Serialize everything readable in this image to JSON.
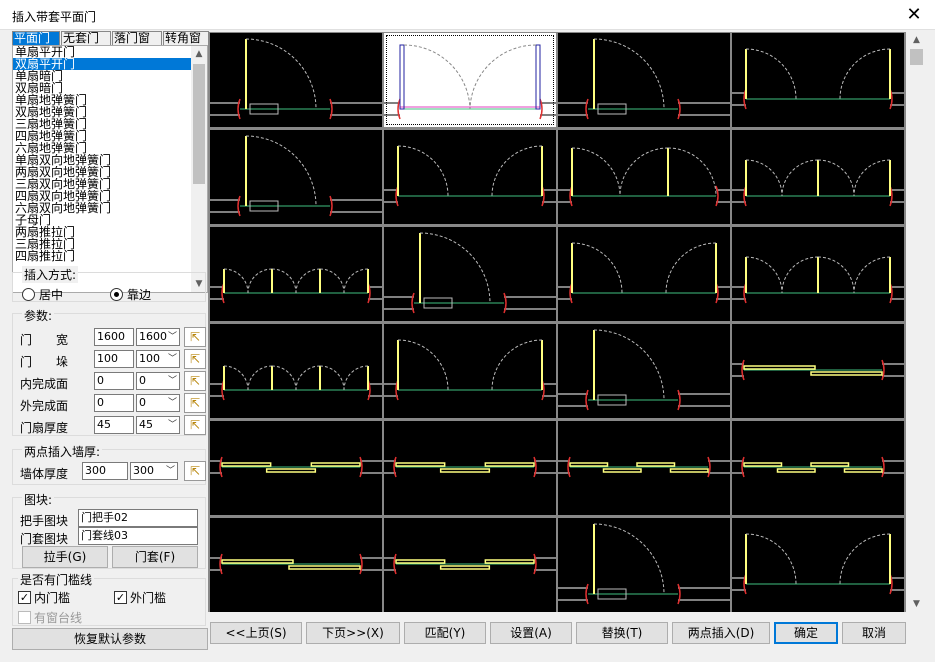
{
  "window": {
    "title": "插入带套平面门",
    "close_glyph": "✕"
  },
  "tabs": [
    {
      "label": "平面门",
      "selected": true
    },
    {
      "label": "无套门",
      "selected": false
    },
    {
      "label": "落门窗",
      "selected": false
    },
    {
      "label": "转角窗",
      "selected": false
    }
  ],
  "list_items": [
    "单扇平开门",
    "双扇平开门",
    "单扇暗门",
    "双扇暗门",
    "单扇地弹簧门",
    "双扇地弹簧门",
    "三扇地弹簧门",
    "四扇地弹簧门",
    "六扇地弹簧门",
    "单扇双向地弹簧门",
    "两扇双向地弹簧门",
    "三扇双向地弹簧门",
    "四扇双向地弹簧门",
    "六扇双向地弹簧门",
    "子母门",
    "两扇推拉门",
    "三扇推拉门",
    "四扇推拉门"
  ],
  "list_selected_index": 1,
  "insert_mode": {
    "label": "插入方式:",
    "options": [
      {
        "label": "居中",
        "checked": false
      },
      {
        "label": "靠边",
        "checked": true
      }
    ]
  },
  "params": {
    "label": "参数:",
    "rows": [
      {
        "label": "门　　宽",
        "value": "1600",
        "select": "1600"
      },
      {
        "label": "门　　垛",
        "value": "100",
        "select": "100"
      },
      {
        "label": "内完成面",
        "value": "0",
        "select": "0"
      },
      {
        "label": "外完成面",
        "value": "0",
        "select": "0"
      },
      {
        "label": "门扇厚度",
        "value": "45",
        "select": "45"
      }
    ]
  },
  "wall": {
    "label": "两点插入墙厚:",
    "row_label": "墙体厚度",
    "value": "300",
    "select": "300"
  },
  "block": {
    "label": "图块:",
    "handle_label": "把手图块",
    "handle_value": "门把手02",
    "frame_label": "门套图块",
    "frame_value": "门套线03",
    "handle_btn": "拉手(G)",
    "frame_btn": "门套(F)"
  },
  "threshold": {
    "label": "是否有门槛线",
    "inner": {
      "label": "内门槛",
      "checked": true
    },
    "outer": {
      "label": "外门槛",
      "checked": true
    },
    "sill": {
      "label": "有窗台线",
      "checked": false
    }
  },
  "restore_btn": "恢复默认参数",
  "bottom_buttons": [
    "<<上页(S)",
    "下页>>(X)",
    "匹配(Y)",
    "设置(A)",
    "替换(T)",
    "两点插入(D)",
    "确定",
    "取消"
  ],
  "default_button_index": 6,
  "grid_selected_index": 1,
  "icons": {
    "pick": "cursor-pick-icon",
    "close": "close-icon"
  },
  "colors": {
    "accent": "#0078d7",
    "door_yellow": "#ffff80",
    "frame_red": "#e03030",
    "wall_white": "#ffffff",
    "threshold_green": "#40c080"
  }
}
